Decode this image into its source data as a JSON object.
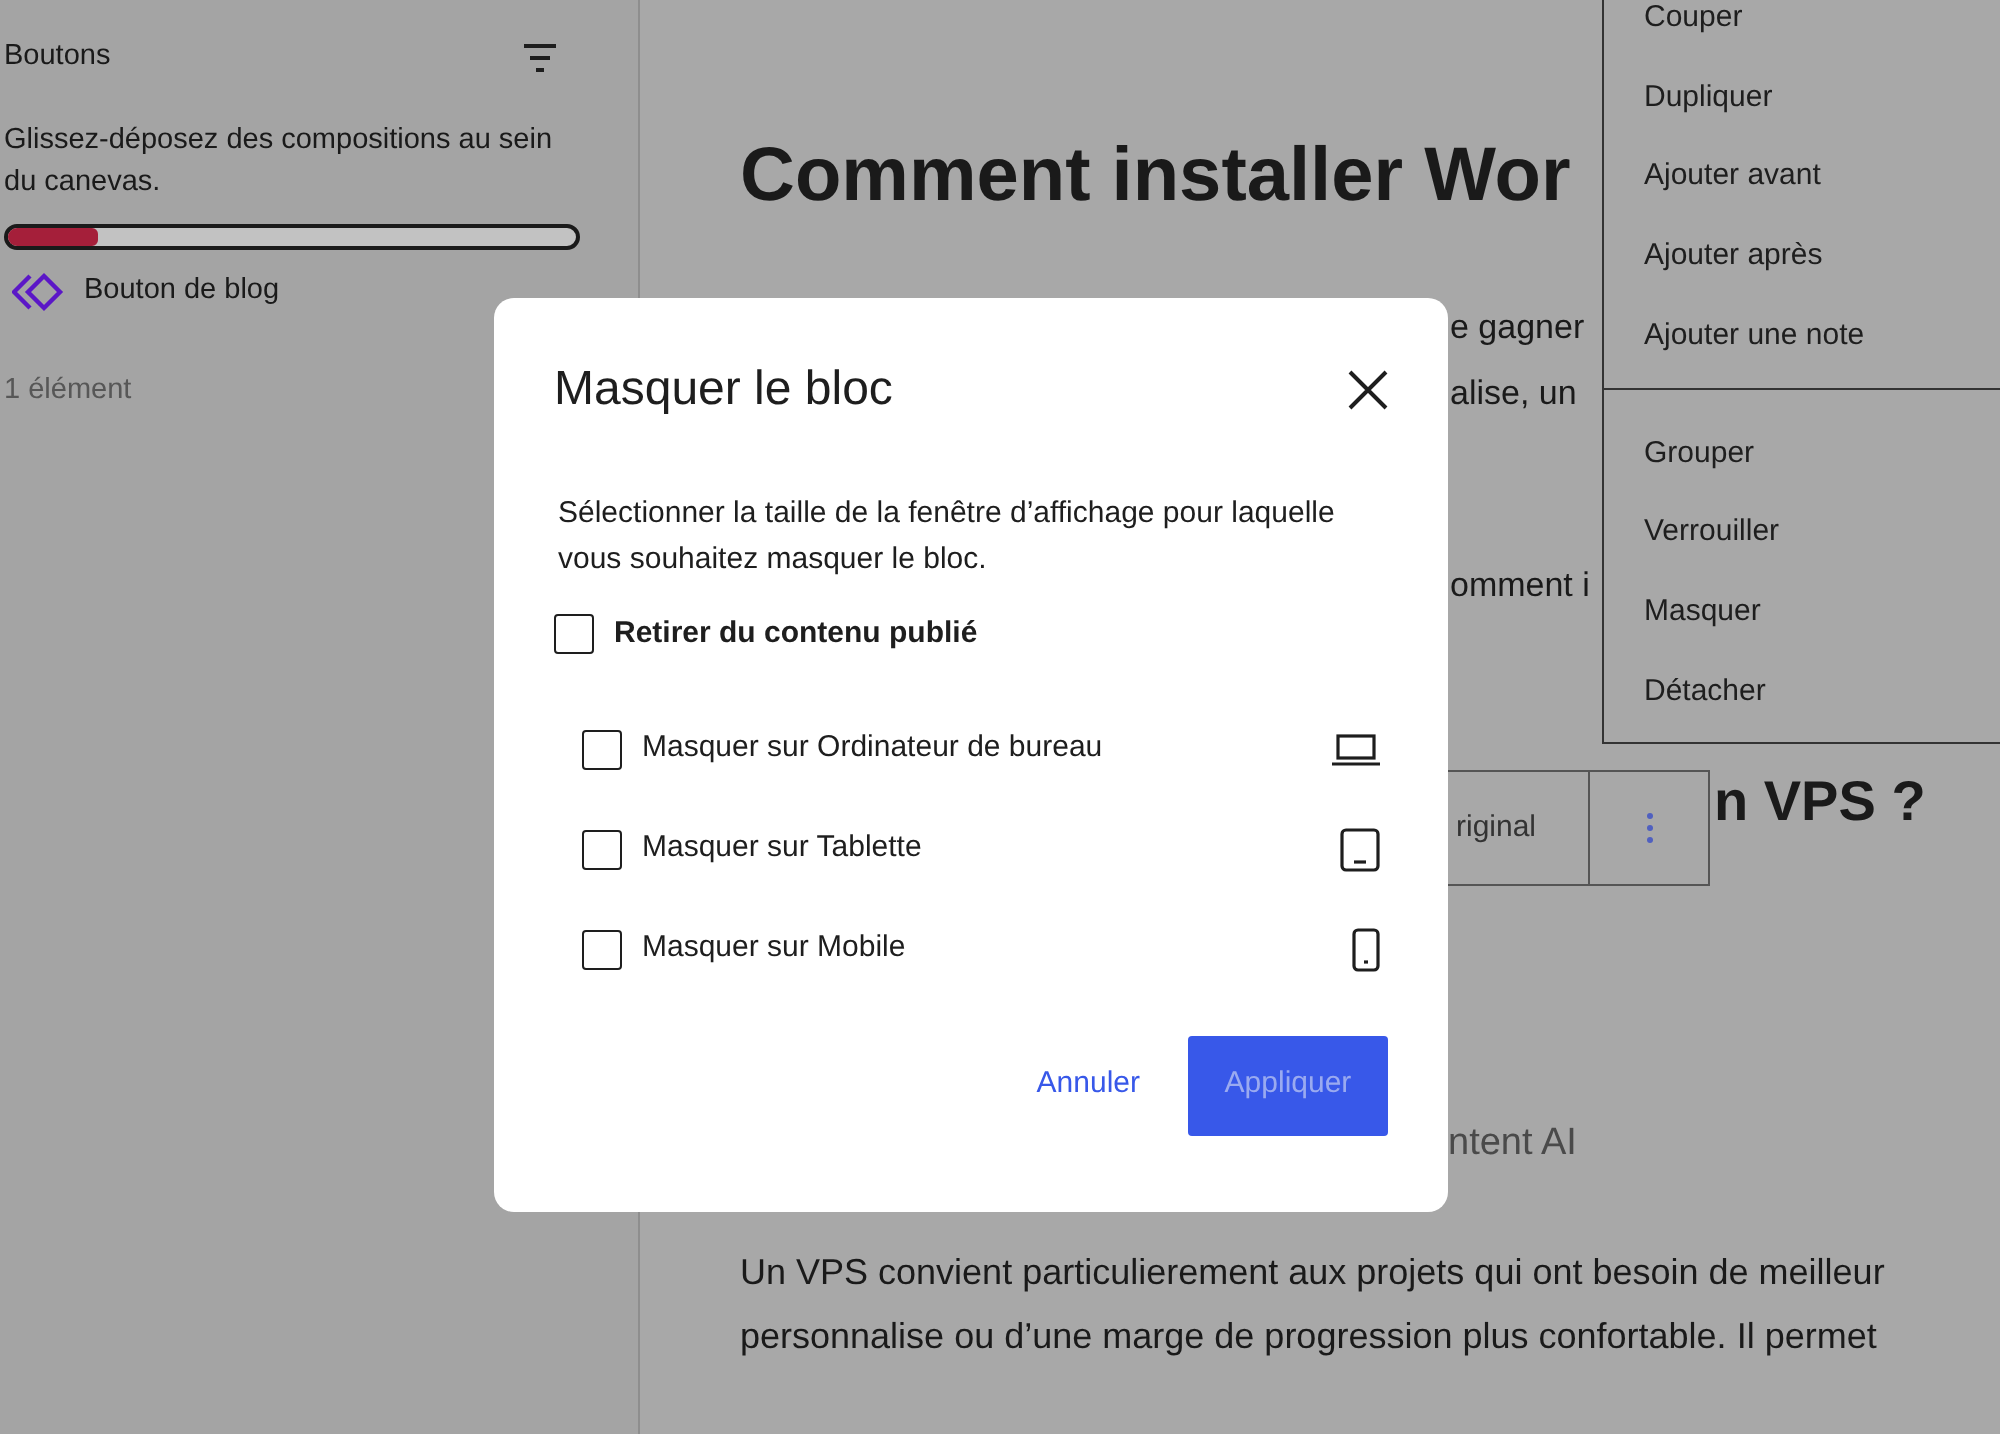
{
  "sidebar": {
    "title": "Boutons",
    "description": "Glissez-déposez des compositions au sein du canevas.",
    "pattern": {
      "name": "Bouton de blog"
    },
    "count": "1 élément"
  },
  "editor": {
    "heading": "Comment installer Wor",
    "fragments": [
      "e gagner",
      "alise, un",
      "omment i"
    ],
    "toolbar": {
      "button": "riginal"
    },
    "subheading": "n VPS ?",
    "caption": "ntent AI",
    "paragraph_lines": [
      "Un VPS convient particulierement aux projets qui ont besoin de meilleur",
      "personnalise ou d’une marge de progression plus confortable. Il permet"
    ]
  },
  "context_menu": {
    "groups": [
      {
        "items": [
          "Couper",
          "Dupliquer",
          "Ajouter avant",
          "Ajouter après",
          "Ajouter une note"
        ]
      },
      {
        "items": [
          "Grouper",
          "Verrouiller",
          "Masquer",
          "Détacher"
        ]
      }
    ]
  },
  "modal": {
    "title": "Masquer le bloc",
    "description": "Sélectionner la taille de la fenêtre d’affichage pour laquelle vous souhaitez masquer le bloc.",
    "publish_option": {
      "label": "Retirer du contenu publié",
      "checked": false
    },
    "devices": [
      {
        "label": "Masquer sur Ordinateur de bureau",
        "kind": "desktop",
        "checked": false
      },
      {
        "label": "Masquer sur Tablette",
        "kind": "tablet",
        "checked": false
      },
      {
        "label": "Masquer sur Mobile",
        "kind": "mobile",
        "checked": false
      }
    ],
    "cancel": "Annuler",
    "apply": {
      "label": "Appliquer",
      "disabled": true
    }
  }
}
